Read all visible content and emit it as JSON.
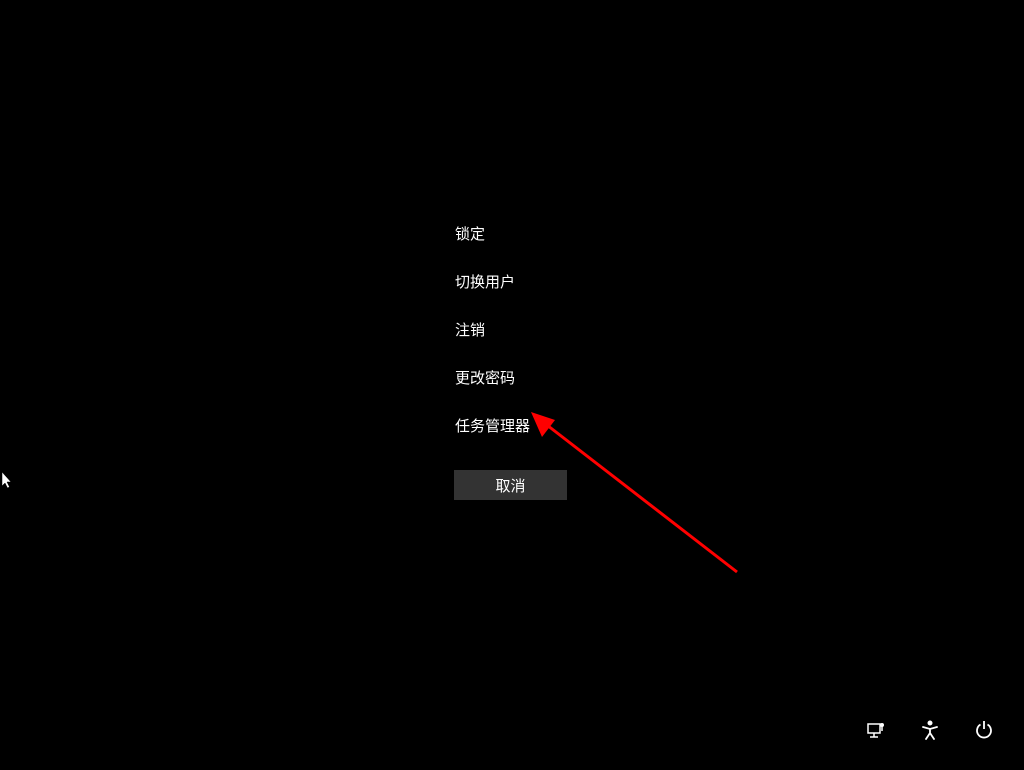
{
  "menu": {
    "items": [
      {
        "label": "锁定"
      },
      {
        "label": "切换用户"
      },
      {
        "label": "注销"
      },
      {
        "label": "更改密码"
      },
      {
        "label": "任务管理器"
      }
    ],
    "cancel_label": "取消"
  },
  "icons": {
    "network": "network-icon",
    "accessibility": "accessibility-icon",
    "power": "power-icon"
  },
  "colors": {
    "background": "#000000",
    "text": "#ffffff",
    "button_bg": "#333333",
    "arrow": "#ff0000"
  }
}
